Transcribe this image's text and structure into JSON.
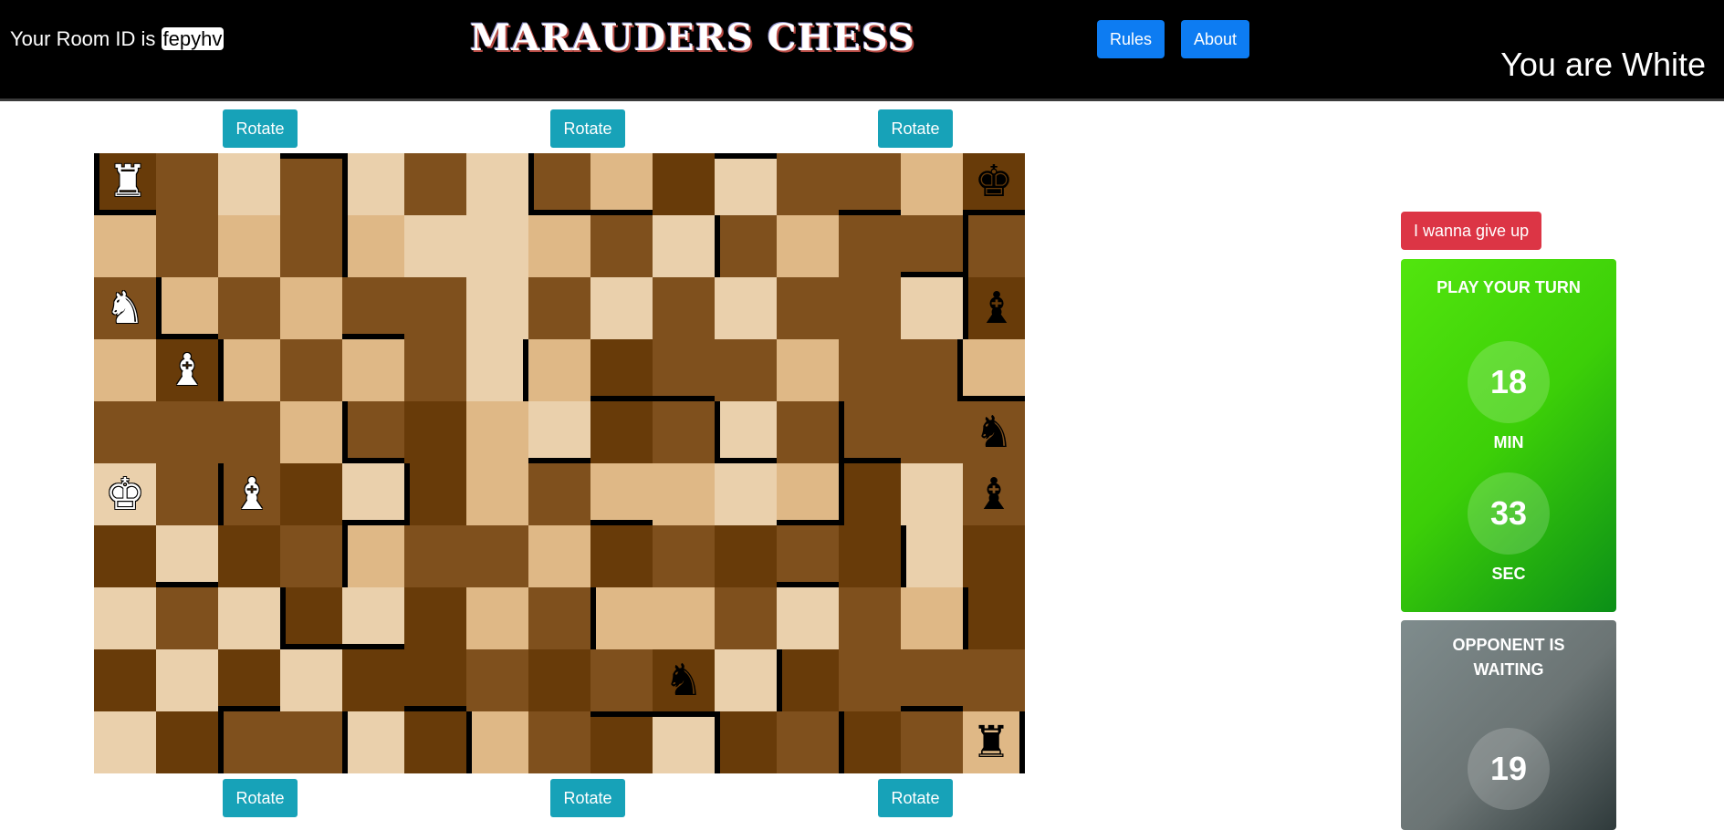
{
  "header": {
    "room_label": "Your Room ID is",
    "room_id": "fepyhv",
    "brand": "MARAUDERS CHESS",
    "rules_label": "Rules",
    "about_label": "About",
    "player_color_text": "You are White"
  },
  "rotate_label": "Rotate",
  "forfeit_label": "I wanna give up",
  "my_timer": {
    "status": "PLAY YOUR TURN",
    "minutes": "18",
    "min_label": "MIN",
    "seconds": "33",
    "sec_label": "SEC"
  },
  "opponent_timer": {
    "status": "OPPONENT IS WAITING",
    "minutes": "19"
  },
  "board": {
    "columns": 15,
    "rows": 10,
    "shades": [
      "320202021302213",
      "121210012021222",
      "212122020202203",
      "131212013221221",
      "222123103202222",
      "022303121101302",
      "303212213232303",
      "020303121120213",
      "303033232303222",
      "032203123032321"
    ],
    "walls": [
      {
        "r": 0,
        "c": 0,
        "w": "lb"
      },
      {
        "r": 0,
        "c": 3,
        "w": "t"
      },
      {
        "r": 0,
        "c": 4,
        "w": "l"
      },
      {
        "r": 0,
        "c": 7,
        "w": "lb"
      },
      {
        "r": 0,
        "c": 8,
        "w": "b"
      },
      {
        "r": 0,
        "c": 10,
        "w": "t"
      },
      {
        "r": 0,
        "c": 12,
        "w": "b"
      },
      {
        "r": 0,
        "c": 14,
        "w": "b"
      },
      {
        "r": 1,
        "c": 4,
        "w": "l"
      },
      {
        "r": 1,
        "c": 10,
        "w": "l"
      },
      {
        "r": 1,
        "c": 13,
        "w": "b"
      },
      {
        "r": 1,
        "c": 14,
        "w": "l"
      },
      {
        "r": 2,
        "c": 1,
        "w": "lb"
      },
      {
        "r": 2,
        "c": 4,
        "w": "b"
      },
      {
        "r": 2,
        "c": 14,
        "w": "l"
      },
      {
        "r": 3,
        "c": 2,
        "w": "l"
      },
      {
        "r": 3,
        "c": 6,
        "w": "r"
      },
      {
        "r": 3,
        "c": 8,
        "w": "b"
      },
      {
        "r": 3,
        "c": 9,
        "w": "b"
      },
      {
        "r": 3,
        "c": 14,
        "w": "b"
      },
      {
        "r": 3,
        "c": 13,
        "w": "r"
      },
      {
        "r": 4,
        "c": 4,
        "w": "lb"
      },
      {
        "r": 4,
        "c": 7,
        "w": "b"
      },
      {
        "r": 4,
        "c": 10,
        "w": "lb"
      },
      {
        "r": 4,
        "c": 12,
        "w": "lb"
      },
      {
        "r": 5,
        "c": 2,
        "w": "l"
      },
      {
        "r": 5,
        "c": 4,
        "w": "b"
      },
      {
        "r": 5,
        "c": 5,
        "w": "l"
      },
      {
        "r": 5,
        "c": 8,
        "w": "b"
      },
      {
        "r": 5,
        "c": 11,
        "w": "b"
      },
      {
        "r": 5,
        "c": 12,
        "w": "l"
      },
      {
        "r": 6,
        "c": 1,
        "w": "b"
      },
      {
        "r": 6,
        "c": 4,
        "w": "l"
      },
      {
        "r": 6,
        "c": 11,
        "w": "b"
      },
      {
        "r": 6,
        "c": 13,
        "w": "l"
      },
      {
        "r": 7,
        "c": 3,
        "w": "lb"
      },
      {
        "r": 7,
        "c": 4,
        "w": "b"
      },
      {
        "r": 7,
        "c": 8,
        "w": "l"
      },
      {
        "r": 7,
        "c": 14,
        "w": "l"
      },
      {
        "r": 8,
        "c": 2,
        "w": "b"
      },
      {
        "r": 8,
        "c": 5,
        "w": "b"
      },
      {
        "r": 8,
        "c": 11,
        "w": "l"
      },
      {
        "r": 8,
        "c": 13,
        "w": "b"
      },
      {
        "r": 9,
        "c": 2,
        "w": "l"
      },
      {
        "r": 9,
        "c": 4,
        "w": "l"
      },
      {
        "r": 9,
        "c": 6,
        "w": "l"
      },
      {
        "r": 9,
        "c": 8,
        "w": "t"
      },
      {
        "r": 9,
        "c": 9,
        "w": "t"
      },
      {
        "r": 9,
        "c": 10,
        "w": "l"
      },
      {
        "r": 9,
        "c": 12,
        "w": "l"
      },
      {
        "r": 9,
        "c": 14,
        "w": "r"
      }
    ],
    "pieces": [
      {
        "r": 0,
        "c": 0,
        "glyph": "♜",
        "side": "w",
        "name": "white-rook"
      },
      {
        "r": 0,
        "c": 14,
        "glyph": "♚",
        "side": "b",
        "name": "black-king"
      },
      {
        "r": 2,
        "c": 0,
        "glyph": "♞",
        "side": "w",
        "name": "white-knight"
      },
      {
        "r": 2,
        "c": 14,
        "glyph": "♝",
        "side": "b",
        "name": "black-bishop"
      },
      {
        "r": 3,
        "c": 1,
        "glyph": "♝",
        "side": "w",
        "name": "white-bishop"
      },
      {
        "r": 4,
        "c": 14,
        "glyph": "♞",
        "side": "b",
        "name": "black-knight"
      },
      {
        "r": 5,
        "c": 0,
        "glyph": "♚",
        "side": "w",
        "name": "white-king"
      },
      {
        "r": 5,
        "c": 2,
        "glyph": "♝",
        "side": "w",
        "name": "white-bishop"
      },
      {
        "r": 5,
        "c": 14,
        "glyph": "♝",
        "side": "b",
        "name": "black-bishop"
      },
      {
        "r": 8,
        "c": 9,
        "glyph": "♞",
        "side": "b",
        "name": "black-knight"
      },
      {
        "r": 9,
        "c": 14,
        "glyph": "♜",
        "side": "b",
        "name": "black-rook"
      }
    ]
  }
}
